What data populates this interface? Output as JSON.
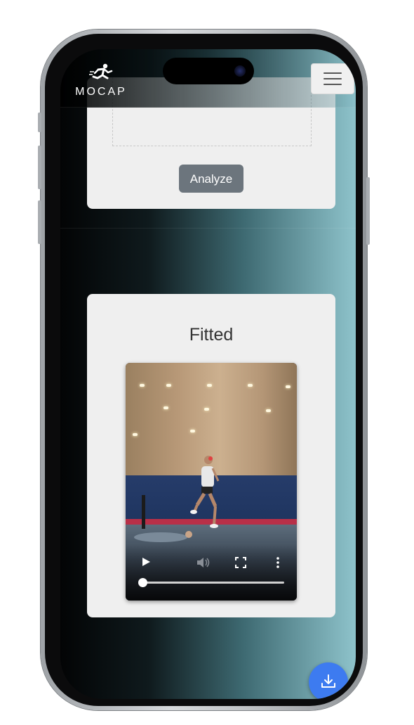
{
  "app": {
    "brand": "MOCAP",
    "logo_icon": "running-figure-icon"
  },
  "header": {
    "menu_icon": "hamburger-menu-icon"
  },
  "upload_card": {
    "analyze_label": "Analyze"
  },
  "result_card": {
    "title": "Fitted",
    "video": {
      "controls": {
        "play_icon": "play-icon",
        "volume_icon": "volume-icon",
        "fullscreen_icon": "fullscreen-icon",
        "more_icon": "more-options-icon"
      },
      "progress": 0.0
    }
  },
  "fab": {
    "icon": "download-icon"
  },
  "colors": {
    "analyze_button": "#6c757d",
    "card_background": "#efefef",
    "fab": "#3d7bf0"
  }
}
